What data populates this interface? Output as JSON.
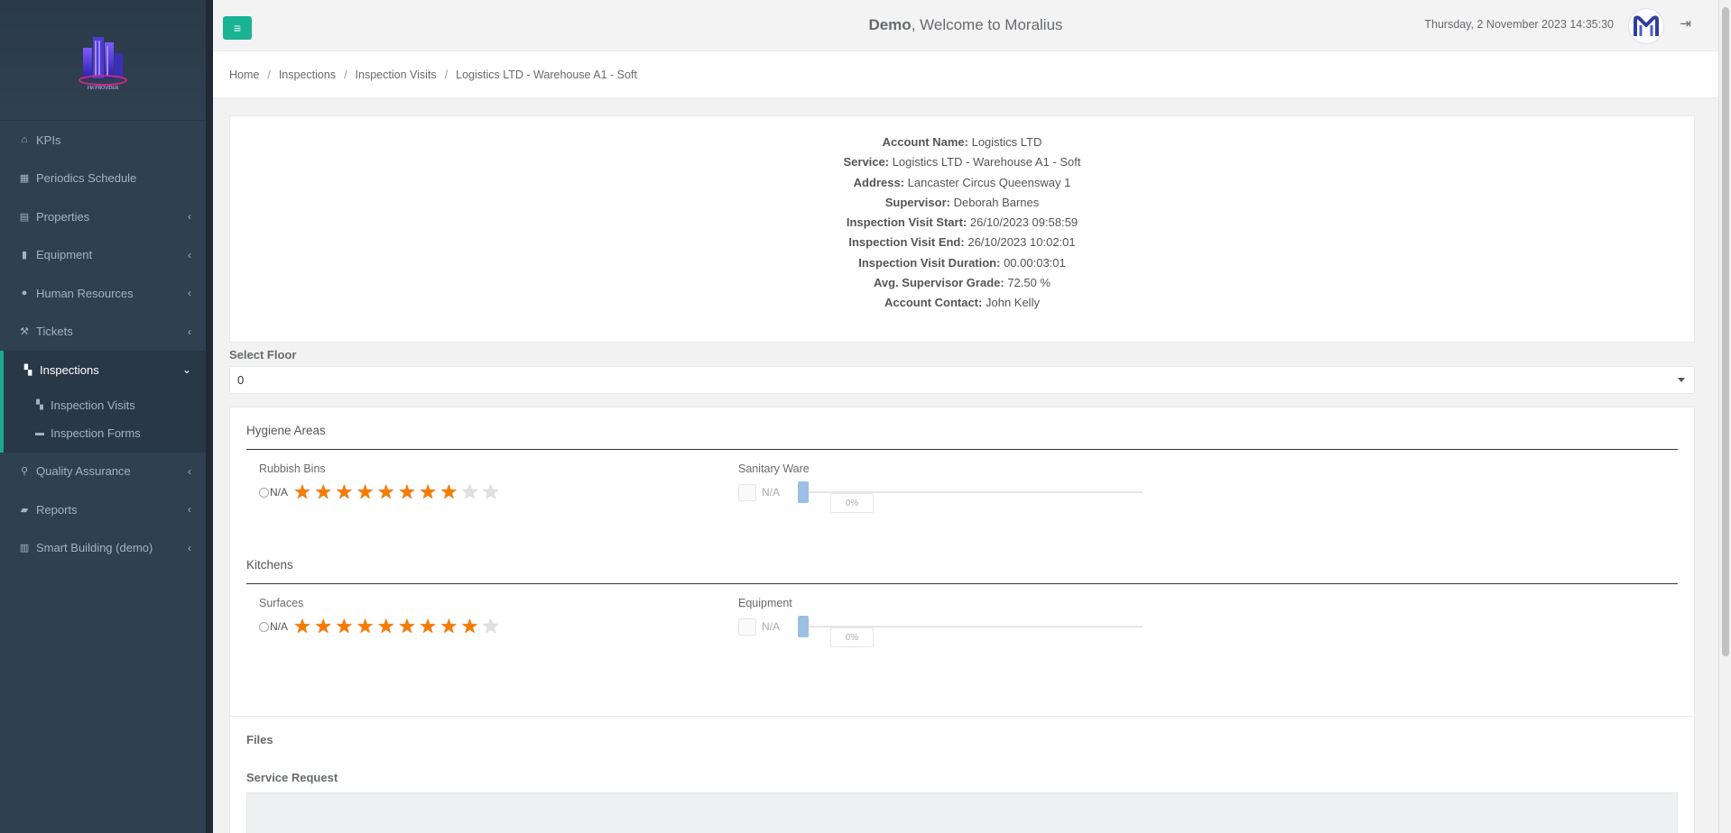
{
  "app": {
    "logo_caption": "FM PROVIDER"
  },
  "sidebar": {
    "items": [
      {
        "label": "KPIs",
        "icon": "home-icon"
      },
      {
        "label": "Periodics Schedule",
        "icon": "calendar-icon"
      },
      {
        "label": "Properties",
        "icon": "building-icon"
      },
      {
        "label": "Equipment",
        "icon": "book-icon"
      },
      {
        "label": "Human Resources",
        "icon": "users-icon"
      },
      {
        "label": "Tickets",
        "icon": "tool-icon"
      },
      {
        "label": "Inspections",
        "icon": "map-icon"
      },
      {
        "label": "Quality Assurance",
        "icon": "search-icon"
      },
      {
        "label": "Reports",
        "icon": "bookmark-icon"
      },
      {
        "label": "Smart Building (demo)",
        "icon": "bar-chart-icon"
      }
    ],
    "sub_items": [
      {
        "label": "Inspection Visits",
        "icon": "map-icon"
      },
      {
        "label": "Inspection Forms",
        "icon": "folder-icon"
      }
    ]
  },
  "topbar": {
    "user": "Demo",
    "welcome": ", Welcome to Moralius",
    "datetime": "Thursday, 2 November 2023 14:35:30",
    "menu_icon": "hamburger-icon",
    "logout_icon": "sign-out-icon",
    "accent": "#1ab394"
  },
  "breadcrumb": [
    "Home",
    "Inspections",
    "Inspection Visits",
    "Logistics LTD - Warehouse A1 - Soft"
  ],
  "info": [
    {
      "label": "Account Name:",
      "value": "Logistics LTD"
    },
    {
      "label": "Service:",
      "value": "Logistics LTD - Warehouse A1 - Soft"
    },
    {
      "label": "Address:",
      "value": "Lancaster Circus Queensway 1"
    },
    {
      "label": "Supervisor:",
      "value": "Deborah Barnes"
    },
    {
      "label": "Inspection Visit Start:",
      "value": "26/10/2023 09:58:59"
    },
    {
      "label": "Inspection Visit End:",
      "value": "26/10/2023 10:02:01"
    },
    {
      "label": "Inspection Visit Duration:",
      "value": "00.00:03:01"
    },
    {
      "label": "Avg. Supervisor Grade:",
      "value": "72.50 %"
    },
    {
      "label": "Account Contact:",
      "value": "John Kelly"
    }
  ],
  "floor": {
    "label": "Select Floor",
    "selected": "0"
  },
  "sections": [
    {
      "title": "Hygiene Areas",
      "left": {
        "label": "Rubbish Bins",
        "na": "N/A",
        "rating": 8,
        "max": 10
      },
      "right": {
        "label": "Sanitary Ware",
        "na": "N/A",
        "percent": "0%",
        "level": 0
      }
    },
    {
      "title": "Kitchens",
      "left": {
        "label": "Surfaces",
        "na": "N/A",
        "rating": 9,
        "max": 10
      },
      "right": {
        "label": "Equipment",
        "na": "N/A",
        "percent": "0%",
        "level": 0
      }
    }
  ],
  "files": {
    "title": "Files",
    "service_request": "Service Request"
  },
  "colors": {
    "sidebar_bg": "#2f4050",
    "star_on": "#f57c00",
    "slider": "#9cc0e3"
  }
}
